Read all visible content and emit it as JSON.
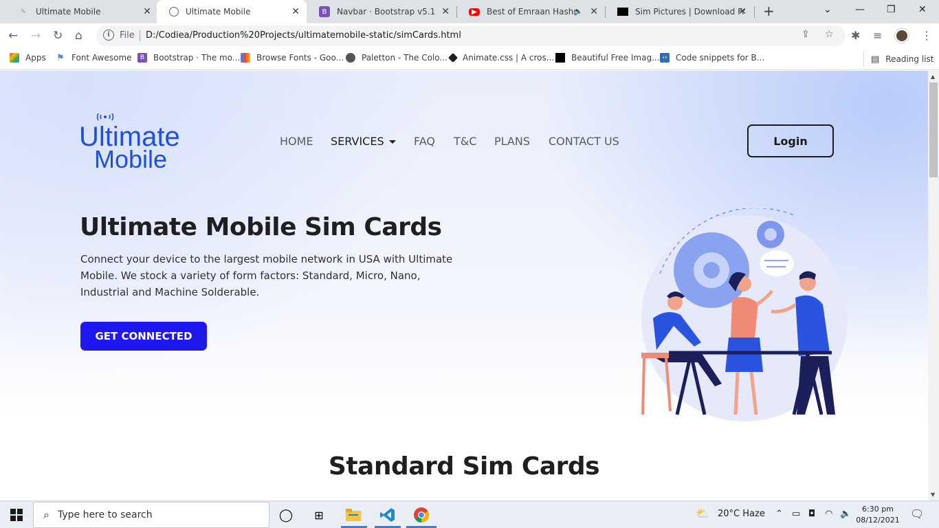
{
  "browser": {
    "tabs": [
      {
        "title": "Ultimate Mobile",
        "active": false
      },
      {
        "title": "Ultimate Mobile",
        "active": true
      },
      {
        "title": "Navbar · Bootstrap v5.1",
        "active": false
      },
      {
        "title": "Best of Emraan Hashmi",
        "active": false
      },
      {
        "title": "Sim Pictures | Download Free",
        "active": false
      }
    ],
    "new_tab": "+",
    "address": {
      "scheme_label": "File",
      "url": "D:/Codiea/Production%20Projects/ultimatemobile-static/simCards.html"
    },
    "bookmarks": [
      {
        "label": "Apps",
        "icon": "apps-grid-icon"
      },
      {
        "label": "Font Awesome",
        "icon": "flag-icon"
      },
      {
        "label": "Bootstrap · The mo...",
        "icon": "bootstrap-icon"
      },
      {
        "label": "Browse Fonts - Goo...",
        "icon": "google-fonts-icon"
      },
      {
        "label": "Paletton - The Colo...",
        "icon": "paletton-icon"
      },
      {
        "label": "Animate.css | A cros...",
        "icon": "animate-icon"
      },
      {
        "label": "Beautiful Free Imag...",
        "icon": "unsplash-icon"
      },
      {
        "label": "Code snippets for B...",
        "icon": "snippets-icon"
      }
    ],
    "reading_list": "Reading list"
  },
  "site": {
    "logo_line1": "Ultimate",
    "logo_line2": "Mobile",
    "nav": [
      {
        "label": "HOME",
        "active": false
      },
      {
        "label": "SERVICES",
        "active": true,
        "dropdown": true
      },
      {
        "label": "FAQ",
        "active": false
      },
      {
        "label": "T&C",
        "active": false
      },
      {
        "label": "PLANS",
        "active": false
      },
      {
        "label": "CONTACT US",
        "active": false
      }
    ],
    "login_label": "Login",
    "hero": {
      "title": "Ultimate Mobile Sim Cards",
      "text": "Connect your device to the largest mobile network in USA with Ultimate Mobile. We stock a variety of form factors: Standard, Micro, Nano, Industrial and Machine Solderable.",
      "cta_label": "GET CONNECTED"
    },
    "section_title": "Standard Sim Cards",
    "colors": {
      "brand_blue": "#1f4fe0",
      "cta_blue": "#1f17f0",
      "text_dark": "#1f1f1f"
    }
  },
  "taskbar": {
    "search_placeholder": "Type here to search",
    "weather": "20°C  Haze",
    "time": "6:30 pm",
    "date": "08/12/2021"
  }
}
